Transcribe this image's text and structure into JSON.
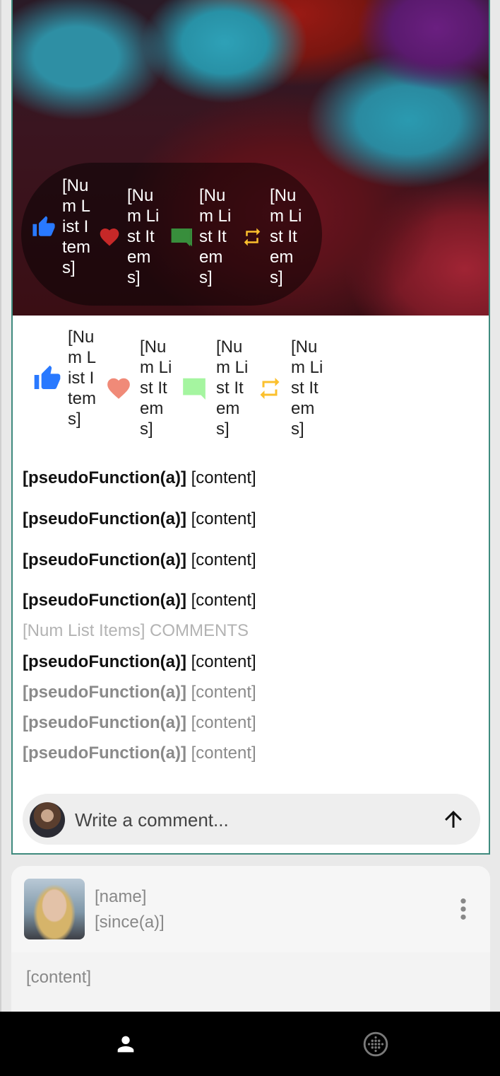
{
  "post": {
    "hero_stats": [
      {
        "icon": "thumbs-up-icon",
        "color": "#2979ff",
        "label": "[Num List Items]"
      },
      {
        "icon": "heart-icon",
        "color": "#c62828",
        "label": "[Num List Items]"
      },
      {
        "icon": "comment-icon",
        "color": "#388e3c",
        "label": "[Num List Items]"
      },
      {
        "icon": "repost-icon",
        "color": "#fbc02d",
        "label": "[Num List Items]"
      }
    ],
    "body_stats": [
      {
        "icon": "thumbs-up-icon",
        "color": "#2979ff",
        "label": "[Num List Items]"
      },
      {
        "icon": "heart-icon",
        "color": "#f08a78",
        "label": "[Num List Items]"
      },
      {
        "icon": "comment-icon",
        "color": "#a5f5a0",
        "label": "[Num List Items]"
      },
      {
        "icon": "repost-icon",
        "color": "#fbc02d",
        "label": "[Num List Items]"
      }
    ],
    "lines": [
      {
        "fn": "[pseudoFunction(a)]",
        "content": "[content]"
      },
      {
        "fn": "[pseudoFunction(a)]",
        "content": "[content]"
      },
      {
        "fn": "[pseudoFunction(a)]",
        "content": "[content]"
      },
      {
        "fn": "[pseudoFunction(a)]",
        "content": "[content]"
      }
    ],
    "comments_count": "[Num List Items] COMMENTS",
    "comments": [
      {
        "fn": "[pseudoFunction(a)]",
        "content": "[content]"
      },
      {
        "fn": "[pseudoFunction(a)]",
        "content": "[content]"
      },
      {
        "fn": "[pseudoFunction(a)]",
        "content": "[content]"
      },
      {
        "fn": "[pseudoFunction(a)]",
        "content": "[content]"
      }
    ],
    "comment_placeholder": "Write a comment..."
  },
  "card2": {
    "name": "[name]",
    "since": "[since(a)]",
    "content": "[content]"
  },
  "nav": {
    "items": [
      {
        "icon": "person-icon"
      },
      {
        "icon": "globe-icon"
      }
    ]
  },
  "colors": {
    "accent_border": "#3f8a7e",
    "nav_bg": "#000000"
  }
}
